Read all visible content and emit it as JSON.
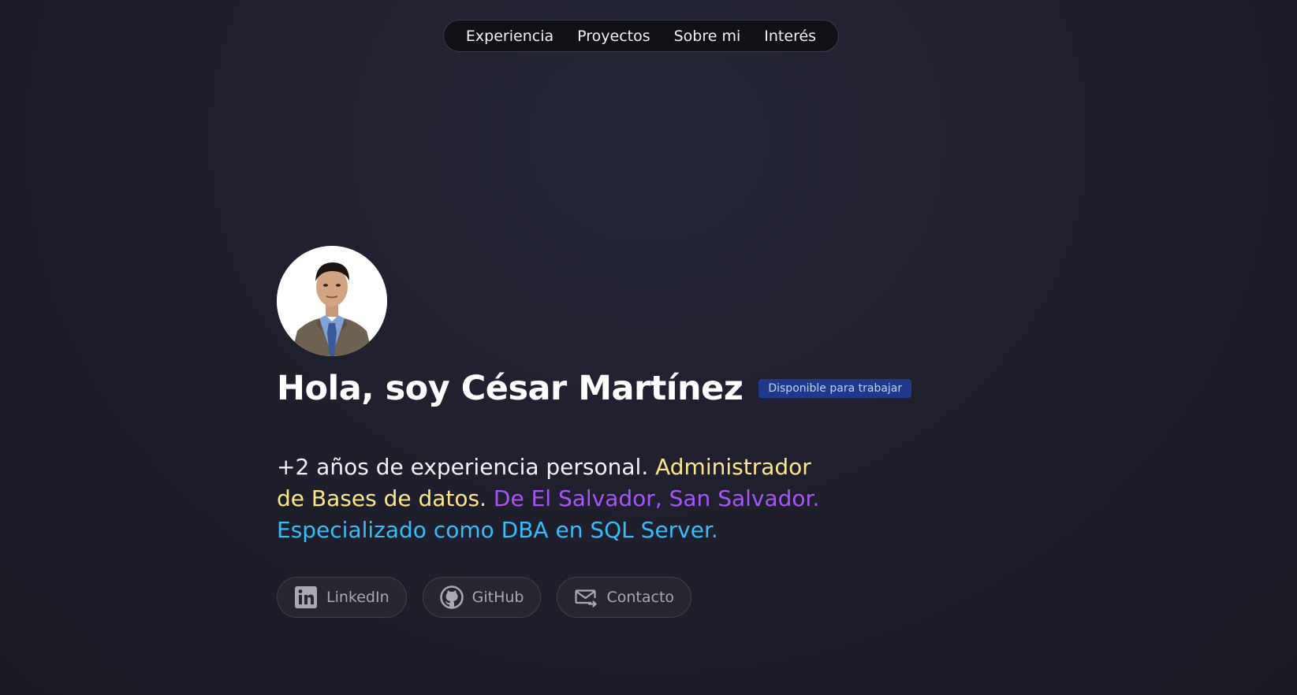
{
  "nav": {
    "items": [
      {
        "label": "Experiencia"
      },
      {
        "label": "Proyectos"
      },
      {
        "label": "Sobre mi"
      },
      {
        "label": "Interés"
      }
    ]
  },
  "hero": {
    "title": "Hola, soy César Martínez",
    "badge": "Disponible para trabajar",
    "intro": {
      "part1": "+2 años de experiencia personal.",
      "part2": "Administrador de Bases de datos.",
      "part3": "De El Salvador, San Salvador.",
      "part4": "Especializado como DBA en SQL Server."
    },
    "colors": {
      "part2": "#fde68a",
      "part3": "#a855f7",
      "part4": "#38bdf8",
      "badge_bg": "#1f3a8a"
    }
  },
  "social": {
    "items": [
      {
        "label": "LinkedIn",
        "icon": "linkedin-icon"
      },
      {
        "label": "GitHub",
        "icon": "github-icon"
      },
      {
        "label": "Contacto",
        "icon": "mail-icon"
      }
    ]
  }
}
